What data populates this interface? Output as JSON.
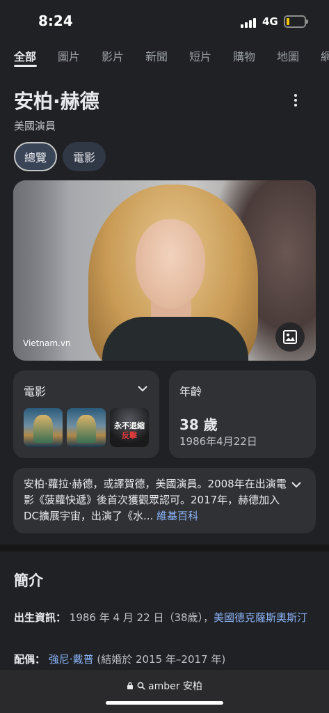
{
  "status": {
    "time": "8:24",
    "network": "4G",
    "battery_level": 0.18
  },
  "tabs": [
    "全部",
    "圖片",
    "影片",
    "新聞",
    "短片",
    "購物",
    "地圖",
    "網"
  ],
  "entity": {
    "name": "安柏·赫德",
    "subtitle": "美國演員"
  },
  "chips": [
    "總覽",
    "電影"
  ],
  "hero": {
    "credit": "Vietnam.vn"
  },
  "movies_card": {
    "title": "電影",
    "thumb3_line1": "永不退縮",
    "thumb3_line2": "反擊"
  },
  "age_card": {
    "title": "年齡",
    "value": "38 歲",
    "birthdate": "1986年4月22日"
  },
  "description": {
    "text": "安柏·蘿拉·赫德，或譯賀德，美國演員。2008年在出演電影《菠蘿快遞》後首次獲觀眾認可。2017年，赫德加入DC擴展宇宙，出演了《水...",
    "source": "維基百科"
  },
  "about": {
    "title": "簡介",
    "birth_label": "出生資訊：",
    "birth_value": "1986 年 4 月 22 日（38歲），",
    "birth_place": "美國德克薩斯奧斯汀",
    "spouse_label": "配偶：",
    "spouse_name": "強尼·戴普",
    "spouse_detail": "(結婚於 2015 年–2017 年)"
  },
  "browser": {
    "url": "amber 安柏"
  }
}
